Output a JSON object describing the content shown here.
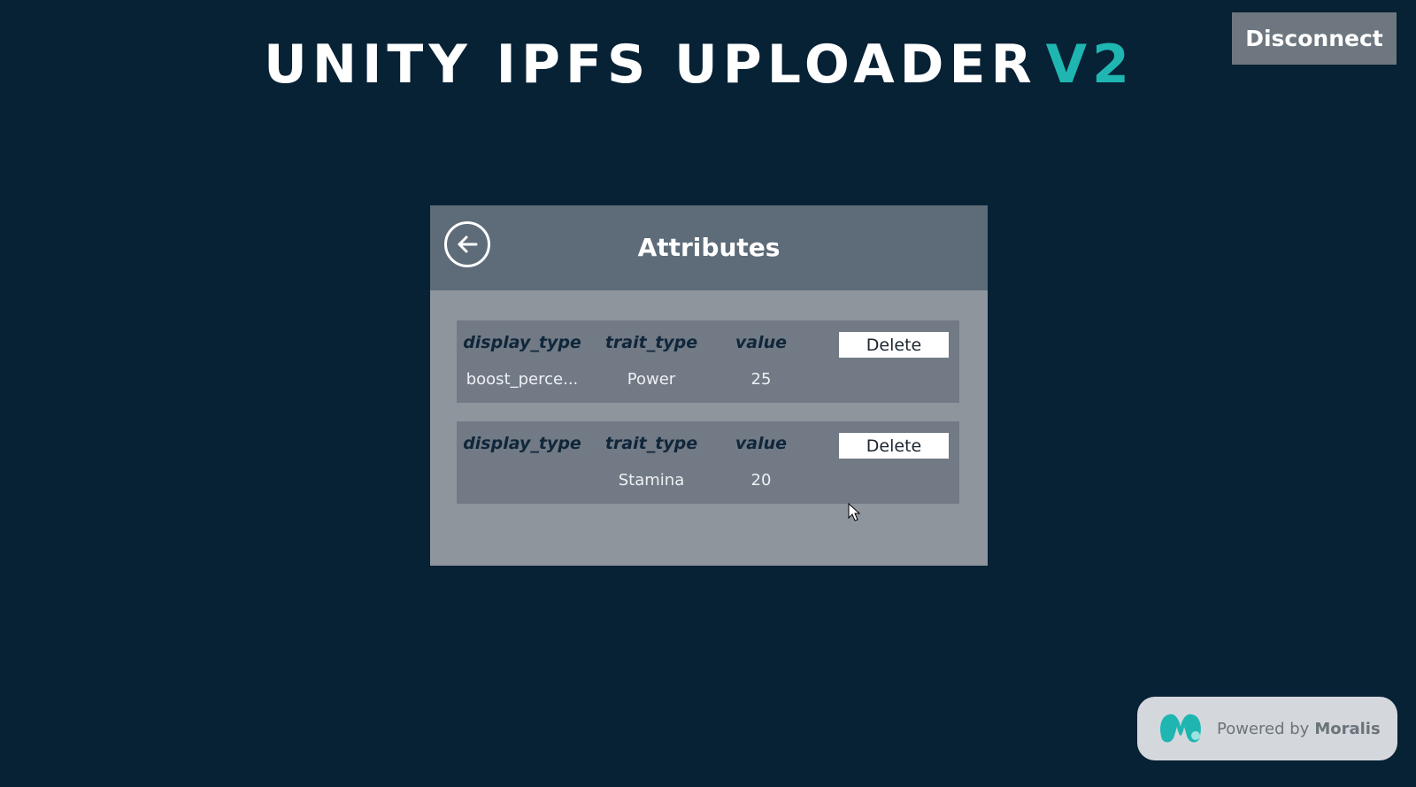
{
  "header": {
    "title_main": "UNITY IPFS UPLOADER",
    "title_accent": "V2",
    "disconnect_label": "Disconnect"
  },
  "panel": {
    "title": "Attributes",
    "back_icon": "arrow-left-circle-icon",
    "attributes": [
      {
        "display_type_header": "display_type",
        "trait_type_header": "trait_type",
        "value_header": "value",
        "display_type": "boost_perce...",
        "trait_type": "Power",
        "value": "25",
        "delete_label": "Delete"
      },
      {
        "display_type_header": "display_type",
        "trait_type_header": "trait_type",
        "value_header": "value",
        "display_type": "",
        "trait_type": "Stamina",
        "value": "20",
        "delete_label": "Delete"
      }
    ]
  },
  "footer": {
    "powered_prefix": "Powered by",
    "powered_brand": "Moralis",
    "logo_icon": "moralis-logo-icon"
  },
  "colors": {
    "background": "#072135",
    "accent": "#1fb6b2",
    "panel_header": "#5e6c79",
    "panel_body": "#8e959d",
    "card": "#717a85"
  }
}
